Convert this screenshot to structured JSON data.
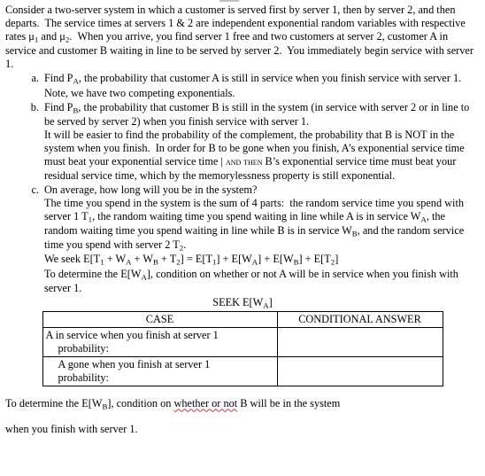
{
  "document": {
    "intro": "Consider a two-server system in which a customer is served first by server 1, then by server 2, and then departs.  The service times at servers 1 & 2 are independent exponential random variables with respective rates μ₁ and μ₂.  When you arrive, you find server 1 free and two customers at server 2, customer A in service and customer B waiting in line to be served by server 2.  You immediately begin service with server 1.",
    "parts": [
      {
        "marker": "a.",
        "lines": [
          "Find Pₐ, the probability that customer A is still in service when you finish service with server 1.  Note, we have two competing exponentials."
        ]
      },
      {
        "marker": "b.",
        "lines": [
          "Find Pʙ, the probability that customer B is still in the system (in service with server 2 or in line to be served by server 2) when you finish service with server 1.",
          "It will be easier to find the probability of the complement, the probability that B is NOT in the system when you finish.  In order for B to be gone when you finish, A's exponential service time must beat your exponential service time | AND THEN B's exponential service time must beat your residual service time, which by the memoryless property is still exponential."
        ]
      },
      {
        "marker": "c.",
        "lines": [
          "On average, how long will you be in the system?",
          "The time you spend in the system is the sum of 4 parts:  the random service time you spend with server 1 T₁, the random waiting time you spend waiting in line while A is in service Wₐ, the random waiting time you spend waiting in line while B is in service Wʙ, and the random service time you spend with server 2 T₂.",
          "We seek E[T₁ + Wₐ + Wʙ + T₂] = E[T₁] + E[Wₐ] + E[Wʙ] + E[T₂]",
          "To determine the E[Wₐ], condition on whether or not A will be in service when you finish with server 1."
        ]
      }
    ],
    "table": {
      "title": "SEEK E[Wₐ]",
      "headers": [
        "CASE",
        "CONDITIONAL ANSWER"
      ],
      "rows": [
        {
          "case_line1": "A in service when you finish at server 1",
          "case_line2": "probability:",
          "answer": ""
        },
        {
          "case_line1": "A gone when you finish at server 1",
          "case_line2": "probability:",
          "answer": ""
        }
      ]
    },
    "closing": {
      "line1_pre": "To determine the E[Wʙ], condition on ",
      "line1_wavy": "whether or not",
      "line1_post": " B will be in the system",
      "line2": "when you finish with server 1."
    }
  }
}
